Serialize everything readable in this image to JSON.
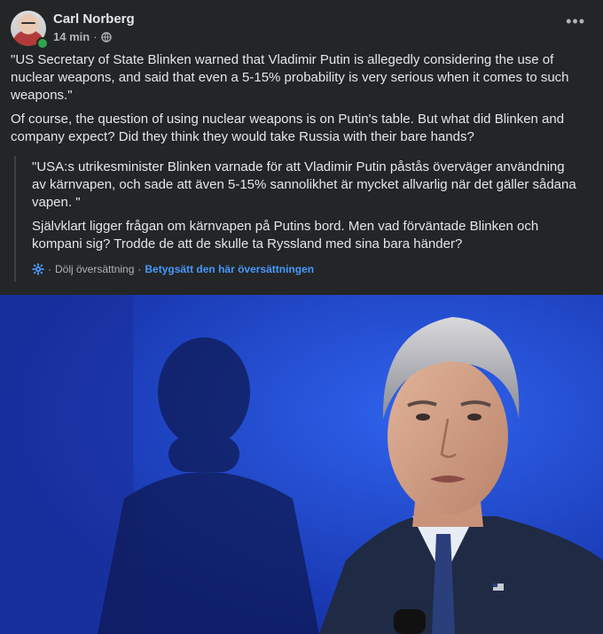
{
  "post": {
    "author": "Carl Norberg",
    "time": "14 min",
    "separator": "·",
    "avatar_icon": "user-avatar-icon",
    "privacy_icon": "globe-icon",
    "more_icon": "more-options-icon",
    "more_glyph": "•••",
    "paragraphs": [
      "\"US Secretary of State Blinken warned that Vladimir Putin is allegedly considering the use of nuclear weapons, and said that even a 5-15% probability is very serious when it comes to such weapons.\"",
      "Of course, the question of using nuclear weapons is on Putin's table. But what did Blinken and company expect? Did they think they would take Russia with their bare hands?"
    ]
  },
  "translation": {
    "paragraphs": [
      "\"USA:s utrikesminister Blinken varnade för att Vladimir Putin påstås överväger användning av kärnvapen, och sade att även 5-15% sannolikhet är mycket allvarlig när det gäller sådana vapen. \"",
      "Självklart ligger frågan om kärnvapen på Putins bord. Men vad förväntade Blinken och kompani sig? Trodde de att de skulle ta Ryssland med sina bara händer?"
    ],
    "settings_icon": "gear-icon",
    "hide_label": "Dölj översättning",
    "rate_label": "Betygsätt den här översättningen",
    "sep": "·"
  },
  "colors": {
    "card_bg": "#242526",
    "text": "#e4e6eb",
    "secondary": "#b0b3b8",
    "link_blue": "#4599ff",
    "online_green": "#31a24c"
  }
}
